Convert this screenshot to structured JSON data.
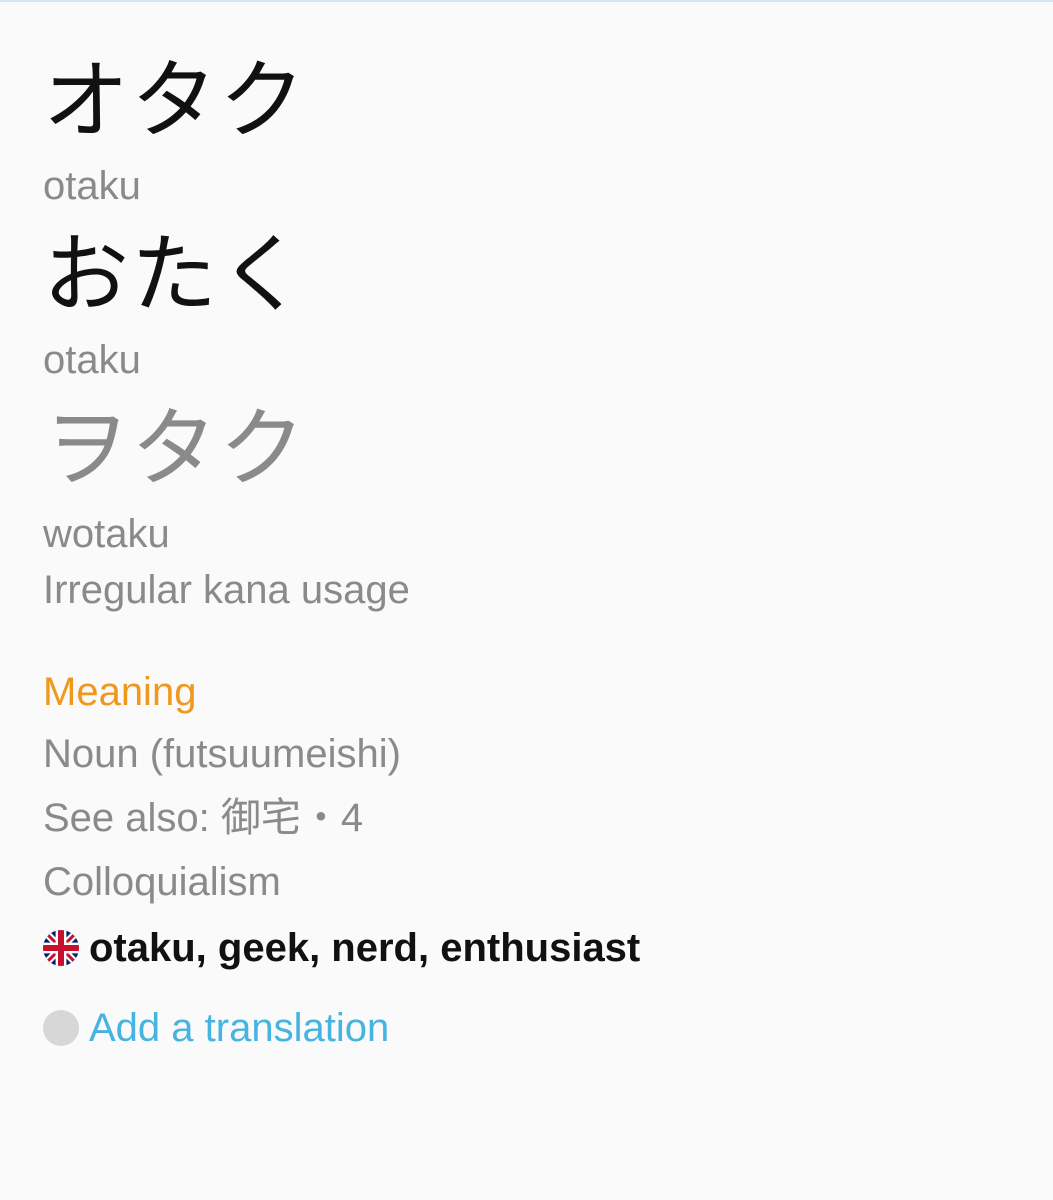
{
  "entry": {
    "forms": [
      {
        "word": "オタク",
        "reading": "otaku"
      },
      {
        "word": "おたく",
        "reading": "otaku"
      },
      {
        "word": "ヲタク",
        "reading": "wotaku",
        "note": "Irregular kana usage"
      }
    ]
  },
  "meaning": {
    "section_title": "Meaning",
    "part_of_speech": "Noun (futsuumeishi)",
    "see_also": "See also: 御宅・4",
    "usage": "Colloquialism",
    "translation": "otaku, geek, nerd, enthusiast",
    "flag_icon": "uk-flag-icon"
  },
  "actions": {
    "add_translation": "Add a translation"
  },
  "colors": {
    "background": "#fafafa",
    "accent_orange": "#f0981e",
    "link_blue": "#45b4e0",
    "muted_gray": "#8a8a8a"
  }
}
